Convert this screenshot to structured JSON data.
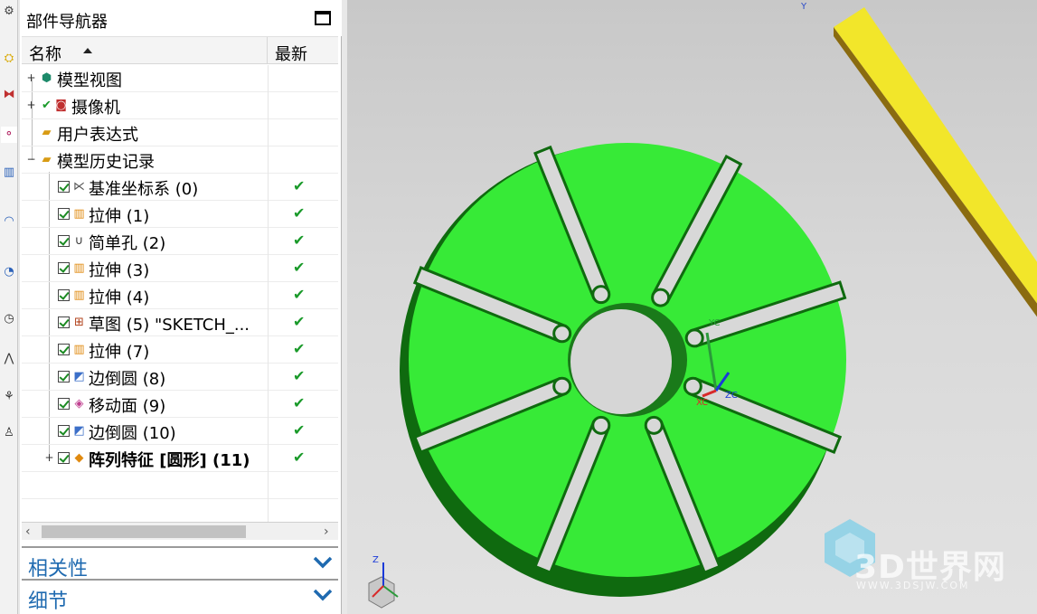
{
  "navigator": {
    "title": "部件导航器",
    "col_name": "名称",
    "col_latest": "最新",
    "nodes": [
      {
        "label": "模型视图",
        "icon": "model-views-icon"
      },
      {
        "label": "摄像机",
        "icon": "camera-icon"
      },
      {
        "label": "用户表达式",
        "icon": "folder-icon"
      },
      {
        "label": "模型历史记录",
        "icon": "folder-open-icon"
      },
      {
        "label": "基准坐标系 (0)",
        "icon": "datum-csys-icon",
        "latest": "✔"
      },
      {
        "label": "拉伸 (1)",
        "icon": "extrude-icon",
        "latest": "✔"
      },
      {
        "label": "简单孔 (2)",
        "icon": "simple-hole-icon",
        "latest": "✔"
      },
      {
        "label": "拉伸 (3)",
        "icon": "extrude-icon",
        "latest": "✔"
      },
      {
        "label": "拉伸 (4)",
        "icon": "extrude-icon",
        "latest": "✔"
      },
      {
        "label": "草图 (5) \"SKETCH_...",
        "icon": "sketch-icon",
        "latest": "✔"
      },
      {
        "label": "拉伸 (7)",
        "icon": "extrude-icon",
        "latest": "✔"
      },
      {
        "label": "边倒圆 (8)",
        "icon": "edge-blend-icon",
        "latest": "✔"
      },
      {
        "label": "移动面 (9)",
        "icon": "move-face-icon",
        "latest": "✔"
      },
      {
        "label": "边倒圆 (10)",
        "icon": "edge-blend-icon",
        "latest": "✔"
      },
      {
        "label": "阵列特征 [圆形] (11)",
        "icon": "pattern-feature-icon",
        "latest": "✔"
      }
    ],
    "dependencies_label": "相关性",
    "details_label": "细节"
  },
  "graphics": {
    "triad_labels": {
      "yc": "YC",
      "xc": "XC",
      "zc": "ZC",
      "z": "Z",
      "y_top": "Y"
    },
    "watermark": {
      "text": "3D世界网",
      "url": "WWW.3DSJW.COM"
    },
    "part_color": "#37ea37",
    "bar_color": "#f2e62a"
  }
}
